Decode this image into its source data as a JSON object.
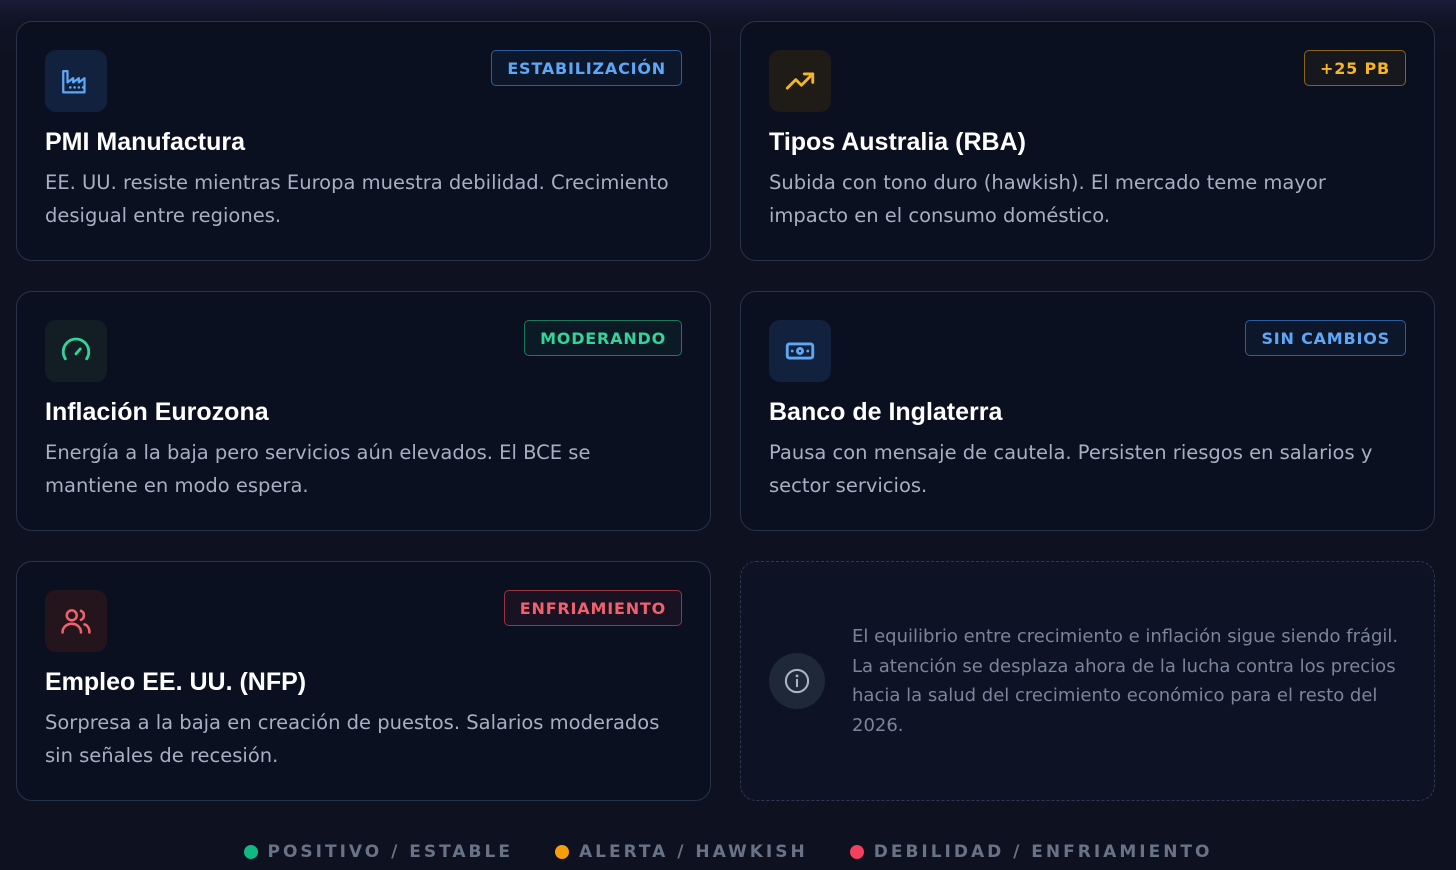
{
  "cards": [
    {
      "title": "PMI Manufactura",
      "description": "EE. UU. resiste mientras Europa muestra debilidad. Crecimiento desigual entre regiones.",
      "badge": "ESTABILIZACIÓN",
      "badge_color": "#5ea7f5",
      "icon": "factory-icon",
      "icon_color": "#5ea7f5"
    },
    {
      "title": "Tipos Australia (RBA)",
      "description": "Subida con tono duro (hawkish). El mercado teme mayor impacto en el consumo doméstico.",
      "badge": "+25 PB",
      "badge_color": "#f5b622",
      "icon": "trending-up-icon",
      "icon_color": "#f5b622"
    },
    {
      "title": "Inflación Eurozona",
      "description": "Energía a la baja pero servicios aún elevados. El BCE se mantiene en modo espera.",
      "badge": "MODERANDO",
      "badge_color": "#34d399",
      "icon": "gauge-icon",
      "icon_color": "#34d399"
    },
    {
      "title": "Banco de Inglaterra",
      "description": "Pausa con mensaje de cautela. Persisten riesgos en salarios y sector servicios.",
      "badge": "SIN CAMBIOS",
      "badge_color": "#5ea7f5",
      "icon": "banknote-icon",
      "icon_color": "#5ea7f5"
    },
    {
      "title": "Empleo EE. UU. (NFP)",
      "description": "Sorpresa a la baja en creación de puestos. Salarios moderados sin señales de recesión.",
      "badge": "ENFRIAMIENTO",
      "badge_color": "#f0616d",
      "icon": "users-icon",
      "icon_color": "#f0616d"
    }
  ],
  "note": {
    "icon": "info-icon",
    "text": "El equilibrio entre crecimiento e inflación sigue siendo frágil. La atención se desplaza ahora de la lucha contra los precios hacia la salud del crecimiento económico para el resto del 2026."
  },
  "legend": [
    {
      "label": "POSITIVO / ESTABLE",
      "color": "#10b981"
    },
    {
      "label": "ALERTA / HAWKISH",
      "color": "#f59e0b"
    },
    {
      "label": "DEBILIDAD / ENFRIAMIENTO",
      "color": "#f43f5e"
    }
  ]
}
